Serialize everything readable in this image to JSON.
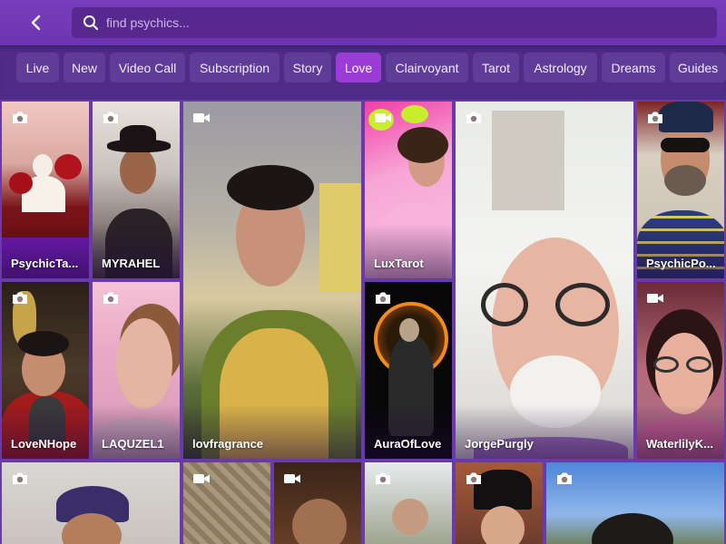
{
  "header": {
    "back_icon": "chevron-left-icon",
    "search_icon": "search-icon",
    "search_placeholder": "find psychics..."
  },
  "tabs": [
    {
      "label": "Live",
      "active": false
    },
    {
      "label": "New",
      "active": false
    },
    {
      "label": "Video Call",
      "active": false
    },
    {
      "label": "Subscription",
      "active": false
    },
    {
      "label": "Story",
      "active": false
    },
    {
      "label": "Love",
      "active": true
    },
    {
      "label": "Clairvoyant",
      "active": false
    },
    {
      "label": "Tarot",
      "active": false
    },
    {
      "label": "Astrology",
      "active": false
    },
    {
      "label": "Dreams",
      "active": false
    },
    {
      "label": "Guides",
      "active": false
    }
  ],
  "psychics": [
    {
      "name": "PsychicTa...",
      "media": "camera-icon"
    },
    {
      "name": "MYRAHEL",
      "media": "camera-icon"
    },
    {
      "name": "lovfragrance",
      "media": "video-camera-icon"
    },
    {
      "name": "LuxTarot",
      "media": "video-camera-icon"
    },
    {
      "name": "JorgePurgly",
      "media": "camera-icon"
    },
    {
      "name": "PsychicPo...",
      "media": "camera-icon"
    },
    {
      "name": "LoveNHope",
      "media": "camera-icon"
    },
    {
      "name": "LAQUZEL1",
      "media": "camera-icon"
    },
    {
      "name": "AuraOfLove",
      "media": "camera-icon"
    },
    {
      "name": "WaterlilyK...",
      "media": "video-camera-icon"
    },
    {
      "name": "",
      "media": "camera-icon"
    },
    {
      "name": "",
      "media": "video-camera-icon"
    },
    {
      "name": "",
      "media": "video-camera-icon"
    },
    {
      "name": "",
      "media": "camera-icon"
    },
    {
      "name": "",
      "media": "camera-icon"
    },
    {
      "name": "",
      "media": "camera-icon"
    }
  ],
  "colors": {
    "header_bg": "#7a3dbd",
    "tab_bg": "#5e3c98",
    "tab_active_bg": "#9b3cd6",
    "tile_border": "#6a3aa8"
  }
}
